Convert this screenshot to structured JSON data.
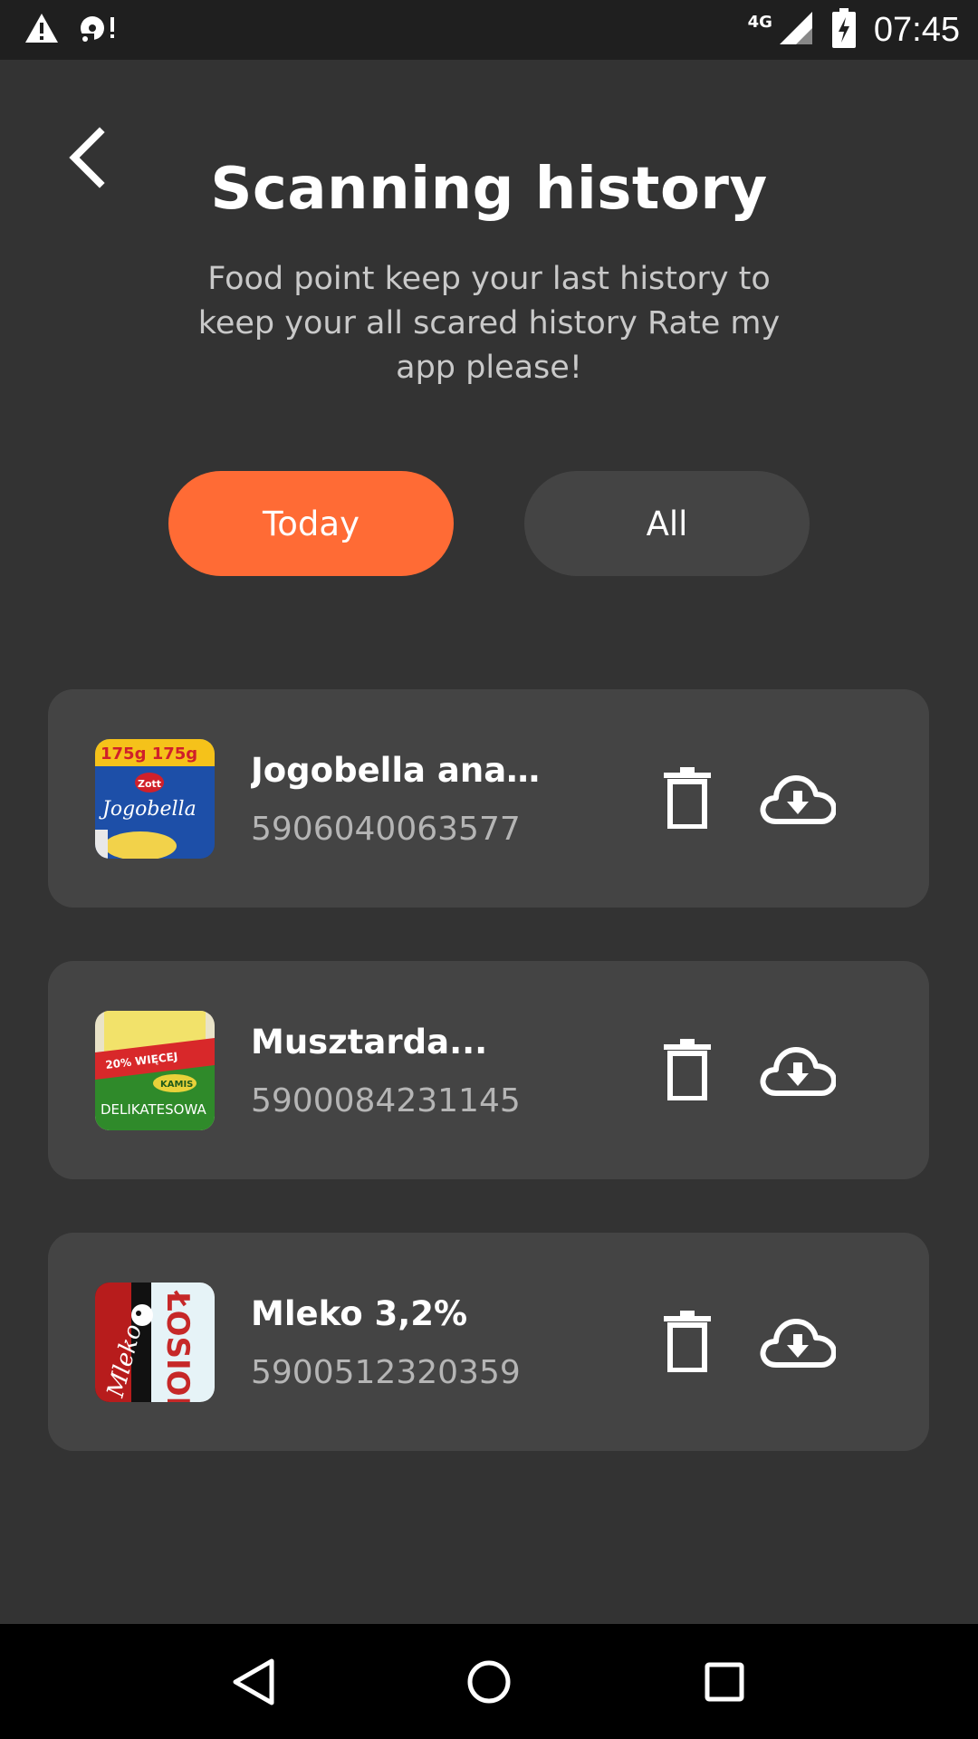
{
  "status_bar": {
    "time": "07:45",
    "network": "4G",
    "icons": [
      "warning-icon",
      "media-icon",
      "signal-icon",
      "battery-charging-icon"
    ]
  },
  "header": {
    "back_icon": "chevron-left-icon",
    "title": "Scanning history",
    "subtitle": "Food point keep your last history to keep your all scared history Rate my app please!"
  },
  "filters": {
    "today_label": "Today",
    "all_label": "All",
    "active": "Today"
  },
  "colors": {
    "accent": "#ff6b35",
    "background": "#333333",
    "card": "#444444",
    "code_text": "#b5b5b5"
  },
  "history": {
    "items": [
      {
        "name": "Jogobella ananas",
        "code": "5906040063577",
        "thumb_label": "Jogobella",
        "thumb_top": "175g 175g",
        "thumb_brand": "Zott"
      },
      {
        "name": "Musztarda...",
        "code": "5900084231145",
        "thumb_label": "DELIKATESOWA",
        "thumb_top": "20% WIĘCEJ",
        "thumb_brand": "KAMIS"
      },
      {
        "name": "Mleko 3,2%",
        "code": "5900512320359",
        "thumb_label": "ŁOSIONE",
        "thumb_top": "Mleko",
        "thumb_brand": ""
      }
    ]
  },
  "nav_bar": {
    "icons": [
      "back-triangle-icon",
      "home-circle-icon",
      "recents-square-icon"
    ]
  }
}
